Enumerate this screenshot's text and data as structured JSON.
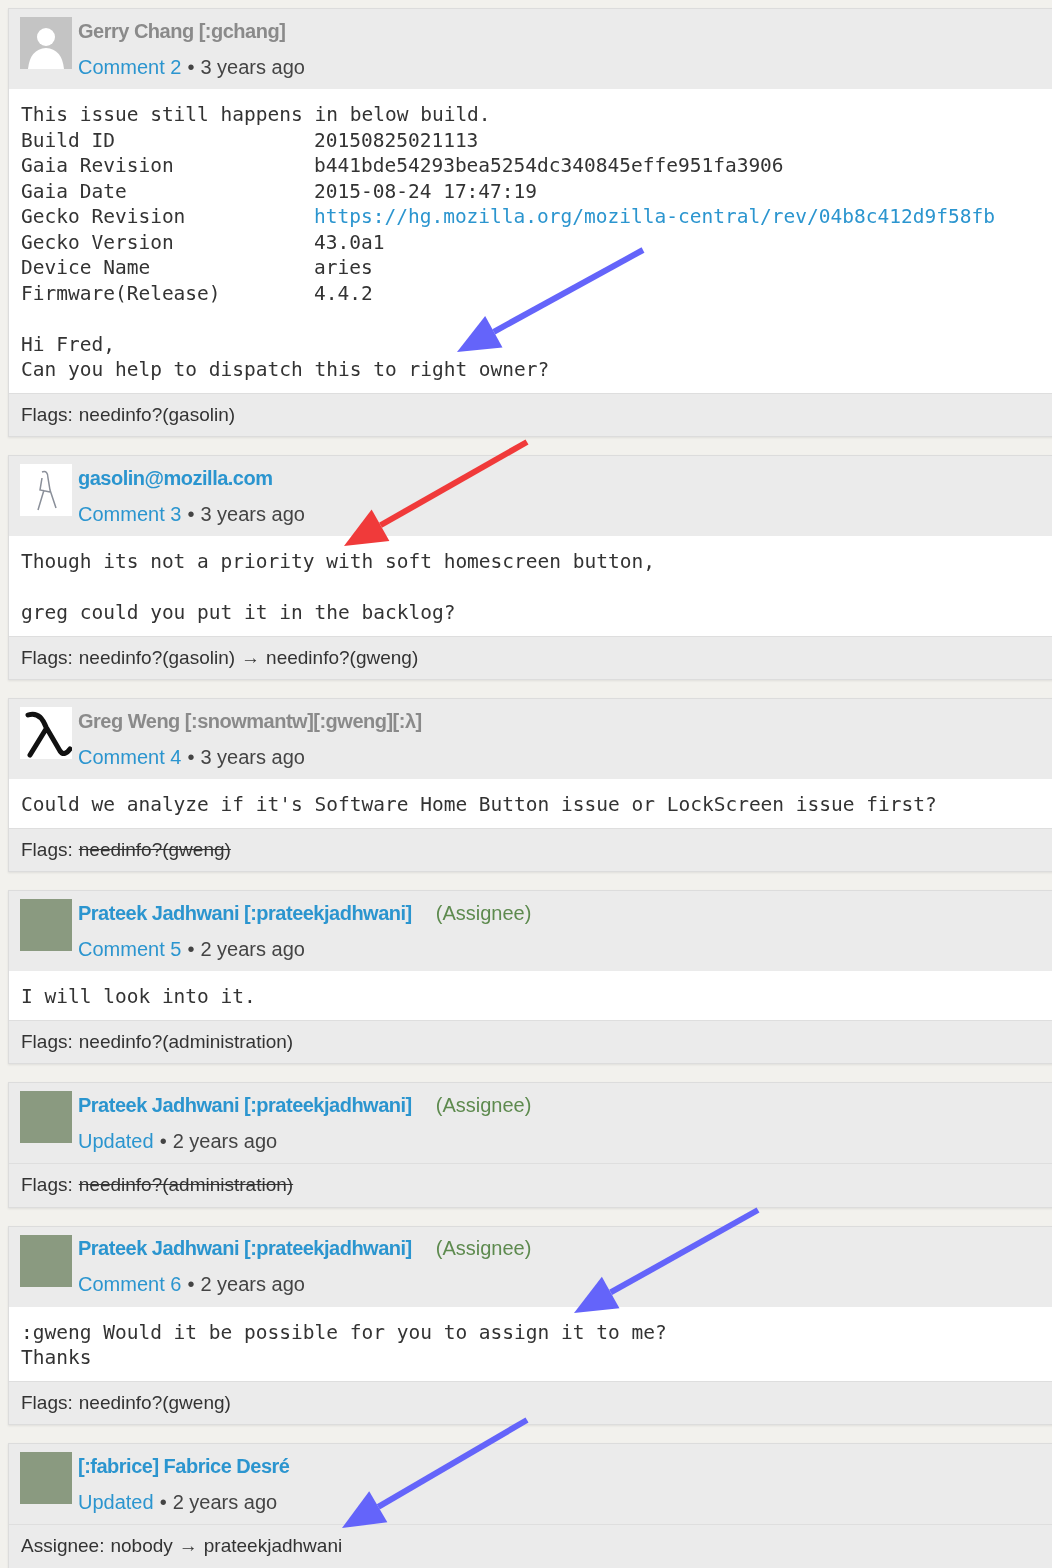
{
  "comments": [
    {
      "author": "Gerry Chang [:gchang]",
      "author_link": false,
      "avatar": {
        "kind": "silhouette"
      },
      "label": "Comment 2",
      "bullet": "•",
      "time": "3 years ago",
      "body": [
        {
          "kind": "text",
          "text": "This issue still happens in below build."
        },
        {
          "kind": "pair",
          "label": "Build ID",
          "value": "20150825021113",
          "link": false
        },
        {
          "kind": "pair",
          "label": "Gaia Revision",
          "value": "b441bde54293bea5254dc340845effe951fa3906",
          "link": false
        },
        {
          "kind": "pair",
          "label": "Gaia Date",
          "value": "2015-08-24 17:47:19",
          "link": false
        },
        {
          "kind": "pair",
          "label": "Gecko Revision",
          "value": "https://hg.mozilla.org/mozilla-central/rev/04b8c412d9f58fb",
          "link": true
        },
        {
          "kind": "pair",
          "label": "Gecko Version",
          "value": "43.0a1",
          "link": false
        },
        {
          "kind": "pair",
          "label": "Device Name",
          "value": "aries",
          "link": false
        },
        {
          "kind": "pair",
          "label": "Firmware(Release)",
          "value": "4.4.2",
          "link": false
        },
        {
          "kind": "gap"
        },
        {
          "kind": "text",
          "text": "Hi Fred,"
        },
        {
          "kind": "text",
          "text": "Can you help to dispatch this to right owner?"
        }
      ],
      "changes": [
        {
          "field": "Flags:",
          "values": [
            {
              "text": "needinfo?(gasolin)",
              "struck": false
            }
          ]
        }
      ]
    },
    {
      "author": "gasolin@mozilla.com",
      "author_link": true,
      "avatar": {
        "kind": "sketch"
      },
      "label": "Comment 3",
      "bullet": "•",
      "time": "3 years ago",
      "body": [
        {
          "kind": "text",
          "text": "Though its not a priority with soft homescreen button,"
        },
        {
          "kind": "gap"
        },
        {
          "kind": "text",
          "text": "greg could you put it in the backlog?"
        }
      ],
      "changes": [
        {
          "field": "Flags:",
          "arrow": "→",
          "values": [
            {
              "text": "needinfo?(gasolin)",
              "struck": false
            },
            {
              "text": "needinfo?(gweng)",
              "struck": false
            }
          ]
        }
      ]
    },
    {
      "author": "Greg Weng [:snowmantw][:gweng][:λ]",
      "author_link": false,
      "avatar": {
        "kind": "lambda"
      },
      "label": "Comment 4",
      "bullet": "•",
      "time": "3 years ago",
      "body": [
        {
          "kind": "text",
          "text": "Could we analyze if it's Software Home Button issue or LockScreen issue first?"
        }
      ],
      "changes": [
        {
          "field": "Flags:",
          "values": [
            {
              "text": "needinfo?(gweng)",
              "struck": true
            }
          ]
        }
      ]
    },
    {
      "author": "Prateek Jadhwani [:prateekjadhwani]",
      "author_link": true,
      "role": "(Assignee)",
      "avatar": {
        "kind": "photo"
      },
      "label": "Comment 5",
      "bullet": "•",
      "time": "2 years ago",
      "body": [
        {
          "kind": "text",
          "text": "I will look into it."
        }
      ],
      "changes": [
        {
          "field": "Flags:",
          "values": [
            {
              "text": "needinfo?(administration)",
              "struck": false
            }
          ]
        }
      ]
    },
    {
      "author": "Prateek Jadhwani [:prateekjadhwani]",
      "author_link": true,
      "role": "(Assignee)",
      "avatar": {
        "kind": "photo"
      },
      "label": "Updated",
      "bullet": "•",
      "time": "2 years ago",
      "changes": [
        {
          "field": "Flags:",
          "values": [
            {
              "text": "needinfo?(administration)",
              "struck": true
            }
          ]
        }
      ]
    },
    {
      "author": "Prateek Jadhwani [:prateekjadhwani]",
      "author_link": true,
      "role": "(Assignee)",
      "avatar": {
        "kind": "photo"
      },
      "label": "Comment 6",
      "bullet": "•",
      "time": "2 years ago",
      "body": [
        {
          "kind": "text",
          "text": ":gweng Would it be possible for you to assign it to me?"
        },
        {
          "kind": "text",
          "text": "Thanks"
        }
      ],
      "changes": [
        {
          "field": "Flags:",
          "values": [
            {
              "text": "needinfo?(gweng)",
              "struck": false
            }
          ]
        }
      ]
    },
    {
      "author": "[:fabrice] Fabrice Desré",
      "author_link": true,
      "avatar": {
        "kind": "photo"
      },
      "label": "Updated",
      "bullet": "•",
      "time": "2 years ago",
      "changes": [
        {
          "field": "Assignee:",
          "arrow": "→",
          "values": [
            {
              "text": "nobody",
              "struck": false
            },
            {
              "text": "prateekjadhwani",
              "struck": false
            }
          ]
        }
      ]
    }
  ],
  "annotations": [
    {
      "color": "#6464fa"
    },
    {
      "color": "#f03a3a"
    },
    {
      "color": "#6464fa"
    },
    {
      "color": "#6464fa"
    }
  ]
}
